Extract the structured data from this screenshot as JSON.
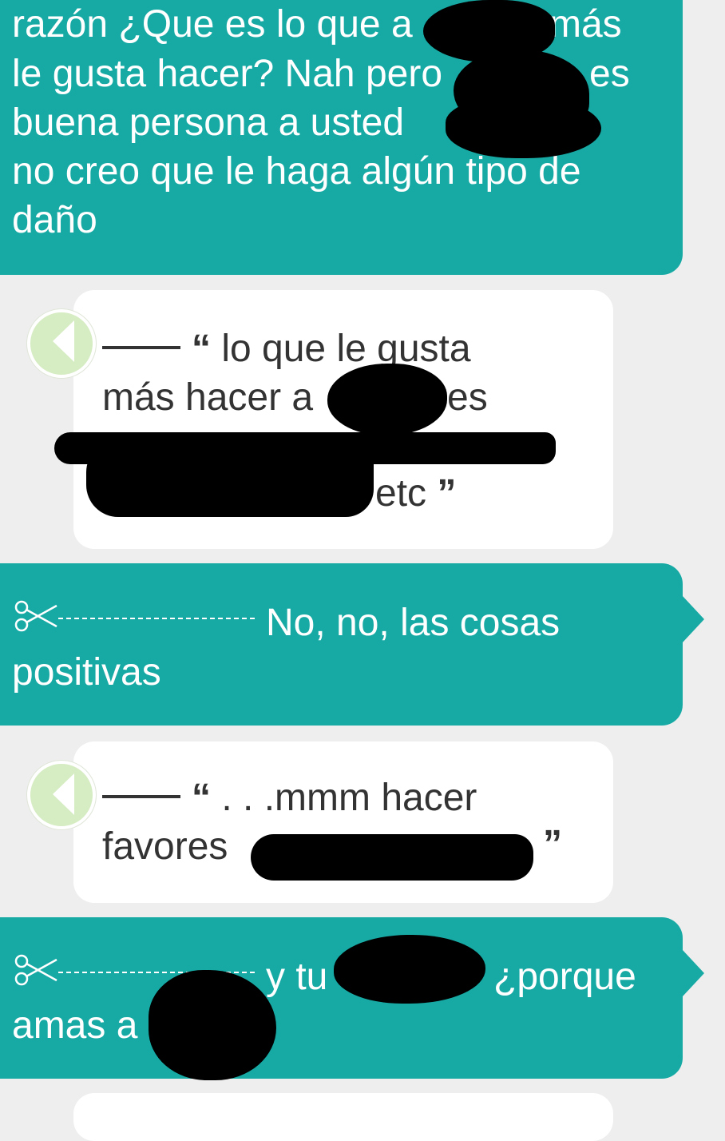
{
  "messages": [
    {
      "side": "sent",
      "lines": [
        "razón ¿Que es lo que a",
        "más",
        "le gusta hacer? Nah pero",
        "es",
        "buena persona a usted",
        "no creo que le haga algún tipo de",
        "daño"
      ]
    },
    {
      "side": "received",
      "open_quote": "“",
      "lines": [
        "lo que le gusta",
        "más hacer a",
        "es",
        "etc"
      ],
      "close_quote": "”"
    },
    {
      "side": "sent",
      "lines": [
        "No, no, las cosas",
        "positivas"
      ]
    },
    {
      "side": "received",
      "open_quote": "“",
      "lines": [
        ". . .mmm hacer",
        "favores"
      ],
      "close_quote": "”"
    },
    {
      "side": "sent",
      "lines": [
        "y tu",
        "¿porque",
        "amas a"
      ]
    }
  ],
  "colors": {
    "sent_bubble": "#17aaa5",
    "received_bubble": "#ffffff",
    "background": "#eeeeee",
    "redaction": "#000000"
  },
  "icons": {
    "cut_marker": "scissors-icon",
    "avatar": "avatar"
  }
}
